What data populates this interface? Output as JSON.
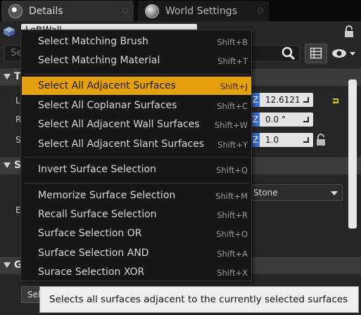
{
  "tabs": [
    {
      "label": "Details",
      "icon": "details-icon"
    },
    {
      "label": "World Settings",
      "icon": "globe-icon"
    }
  ],
  "details": {
    "name_value": "LeftWall",
    "search_placeholder": "Se",
    "section_transform_initial": "T",
    "section_surface_initial": "S",
    "section_geometry_initial": "G",
    "row_initials": [
      "L",
      "R",
      "S",
      "E"
    ],
    "location_z": "12.6121",
    "rotation_z": "0.0 °",
    "scale_z": "1.0",
    "z_label": "Z",
    "material_value": "Stone",
    "bottom_button": "Sel"
  },
  "context_menu": {
    "items": [
      {
        "label": "Select Matching Brush",
        "shortcut": "Shift+B"
      },
      {
        "label": "Select Matching Material",
        "shortcut": "Shift+T"
      },
      {
        "label": "Select All Adjacent Surfaces",
        "shortcut": "Shift+J",
        "active": true
      },
      {
        "label": "Select All Coplanar Surfaces",
        "shortcut": "Shift+C"
      },
      {
        "label": "Select All Adjacent Wall Surfaces",
        "shortcut": "Shift+W"
      },
      {
        "label": "Select All Adjacent Slant Surfaces",
        "shortcut": "Shift+Y"
      },
      {
        "label": "Invert Surface Selection",
        "shortcut": "Shift+Q"
      },
      {
        "label": "Memorize Surface Selection",
        "shortcut": "Shift+M"
      },
      {
        "label": "Recall Surface Selection",
        "shortcut": "Shift+R"
      },
      {
        "label": "Surface Selection OR",
        "shortcut": "Shift+O"
      },
      {
        "label": "Surface Selection AND",
        "shortcut": "Shift+A"
      },
      {
        "label": "Surace Selection XOR",
        "shortcut": "Shift+X"
      }
    ]
  },
  "tooltip": {
    "text": "Selects all surfaces adjacent to the currently selected surfaces"
  },
  "colors": {
    "highlight": "#e5a00f",
    "axis_z": "#3a6fd0",
    "menu_bg": "#161616",
    "panel_bg": "#262626"
  }
}
